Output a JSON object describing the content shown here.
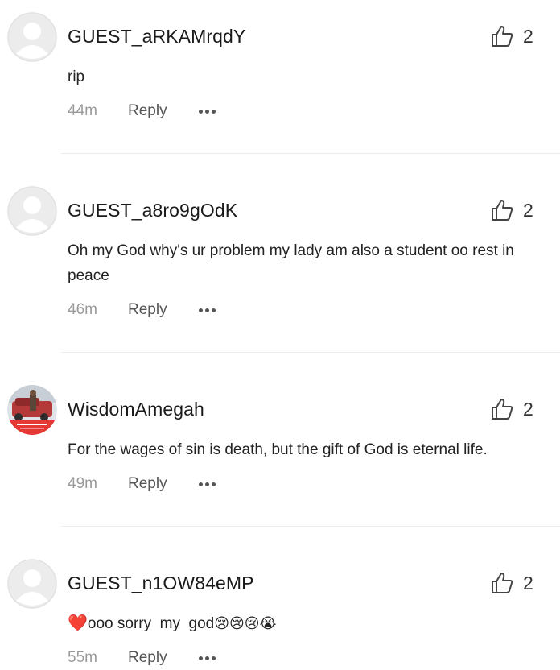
{
  "comments": [
    {
      "username": "GUEST_aRKAMrqdY",
      "likes": "2",
      "body": "rip",
      "time": "44m",
      "reply_label": "Reply",
      "avatar_type": "default"
    },
    {
      "username": "GUEST_a8ro9gOdK",
      "likes": "2",
      "body": "Oh my God why's ur problem my lady am also a student oo rest in peace",
      "time": "46m",
      "reply_label": "Reply",
      "avatar_type": "default"
    },
    {
      "username": "WisdomAmegah",
      "likes": "2",
      "body": "For the wages of sin is death, but the gift of God is eternal life.",
      "time": "49m",
      "reply_label": "Reply",
      "avatar_type": "photo"
    },
    {
      "username": "GUEST_n1OW84eMP",
      "likes": "2",
      "body_heart": "❤️",
      "body": "ooo sorry  my  god",
      "body_emojis": "😢😢😢😭",
      "time": "55m",
      "reply_label": "Reply",
      "avatar_type": "default"
    }
  ],
  "icons": {
    "like": "thumbs-up-icon",
    "more": "more-horizontal-icon",
    "avatar": "default-avatar-icon"
  },
  "colors": {
    "text": "#222222",
    "muted": "#9a9a9a",
    "divider": "#ececec",
    "avatar_bg": "#e6e6e6"
  }
}
